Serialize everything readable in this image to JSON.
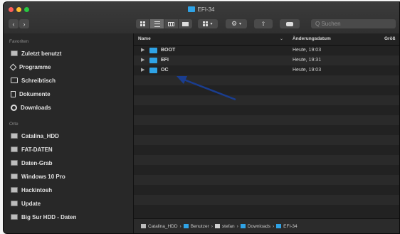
{
  "window": {
    "title": "EFI-34"
  },
  "toolbar": {
    "back": "‹",
    "forward": "›",
    "search_placeholder": "Q Suchen"
  },
  "sidebar": {
    "favorites_header": "Favoriten",
    "favorites": [
      {
        "label": "Zuletzt benutzt",
        "icon": "clock-icon"
      },
      {
        "label": "Programme",
        "icon": "apps-icon"
      },
      {
        "label": "Schreibtisch",
        "icon": "desktop-icon"
      },
      {
        "label": "Dokumente",
        "icon": "document-icon"
      },
      {
        "label": "Downloads",
        "icon": "download-icon"
      }
    ],
    "places_header": "Orte",
    "places": [
      {
        "label": "Catalina_HDD"
      },
      {
        "label": "FAT-DATEN"
      },
      {
        "label": "Daten-Grab"
      },
      {
        "label": "Windows 10 Pro"
      },
      {
        "label": "Hackintosh"
      },
      {
        "label": "Update"
      },
      {
        "label": "Big Sur HDD - Daten"
      }
    ]
  },
  "columns": {
    "name": "Name",
    "date": "Änderungsdatum",
    "size": "Größ"
  },
  "files": [
    {
      "name": "BOOT",
      "date": "Heute, 19:03"
    },
    {
      "name": "EFI",
      "date": "Heute, 19:31"
    },
    {
      "name": "OC",
      "date": "Heute, 19:03"
    }
  ],
  "pathbar": [
    "Catalina_HDD",
    "Benutzer",
    "stefan",
    "Downloads",
    "EFI-34"
  ],
  "annotation": {
    "arrow_color": "#1a3d8f"
  }
}
